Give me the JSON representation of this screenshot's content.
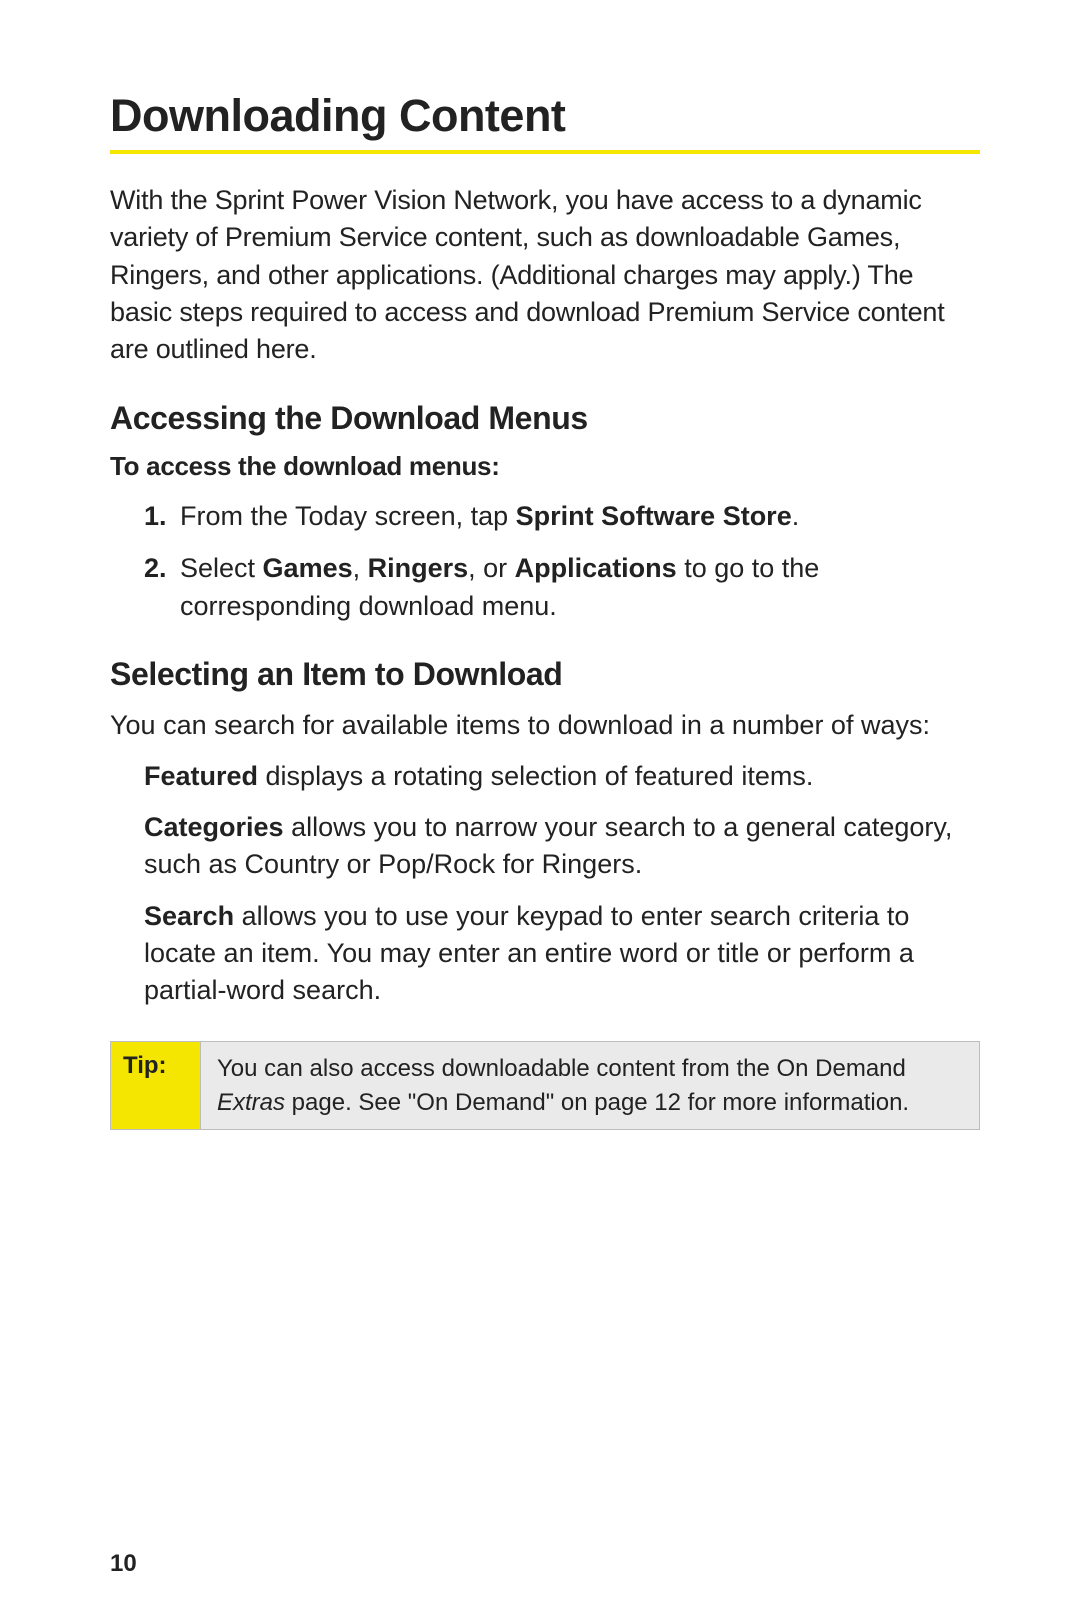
{
  "page": {
    "title": "Downloading Content",
    "intro": "With the Sprint Power Vision Network, you have access to a dynamic variety of Premium Service content, such as downloadable Games, Ringers, and other applications. (Additional charges may apply.) The basic steps required to access and download Premium Service content are outlined here.",
    "section1": {
      "heading": "Accessing the Download Menus",
      "lead": "To access the download menus:",
      "steps": {
        "s1_pre": "From the Today screen, tap ",
        "s1_bold": "Sprint Software Store",
        "s1_post": ".",
        "s2_pre": "Select ",
        "s2_b1": "Games",
        "s2_sep1": ", ",
        "s2_b2": "Ringers",
        "s2_sep2": ", or ",
        "s2_b3": "Applications",
        "s2_post": " to go to the corresponding download menu."
      }
    },
    "section2": {
      "heading": "Selecting an Item to Download",
      "intro": "You can search for available items to download in a number of ways:",
      "featured_b": "Featured",
      "featured_rest": " displays a rotating selection of featured items.",
      "categories_b": "Categories",
      "categories_rest": " allows you to narrow your search to a general category, such as Country or Pop/Rock for Ringers.",
      "search_b": "Search",
      "search_rest": " allows you to use your keypad to enter search criteria to locate an item. You may enter an entire word or title or perform a partial-word search."
    },
    "tip": {
      "label": "Tip:",
      "line1": "You can also access downloadable content from the On Demand ",
      "em": "Extras",
      "line2": " page. See \"On Demand\" on page 12 for more information."
    },
    "pageNumber": "10"
  }
}
